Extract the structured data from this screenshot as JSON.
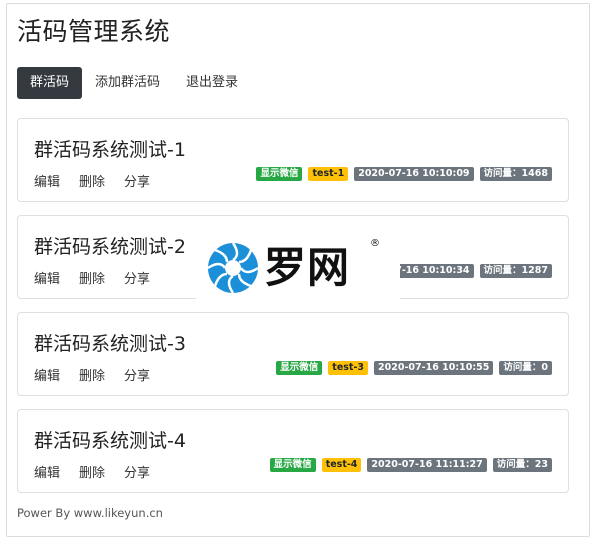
{
  "app": {
    "title": "活码管理系统"
  },
  "nav": {
    "items": [
      {
        "label": "群活码",
        "active": true
      },
      {
        "label": "添加群活码",
        "active": false
      },
      {
        "label": "退出登录",
        "active": false
      }
    ]
  },
  "actions": {
    "edit": "编辑",
    "delete": "删除",
    "share": "分享"
  },
  "cards": [
    {
      "title": "群活码系统测试-1",
      "wechat": "显示微信",
      "tag": "test-1",
      "time": "2020-07-16 10:10:09",
      "visits": "访问量：1468"
    },
    {
      "title": "群活码系统测试-2",
      "wechat": "",
      "tag": "",
      "time": "07-16 10:10:34",
      "visits": "访问量：1287"
    },
    {
      "title": "群活码系统测试-3",
      "wechat": "显示微信",
      "tag": "test-3",
      "time": "2020-07-16 10:10:55",
      "visits": "访问量：0"
    },
    {
      "title": "群活码系统测试-4",
      "wechat": "显示微信",
      "tag": "test-4",
      "time": "2020-07-16 11:11:27",
      "visits": "访问量：23"
    }
  ],
  "footer": {
    "text": "Power By www.likeyun.cn"
  },
  "watermark": {
    "text": "罗网",
    "reg": "®"
  },
  "colors": {
    "nav_active": "#343a40",
    "badge_green": "#28a745",
    "badge_yellow": "#ffc107",
    "badge_gray": "#6c757d",
    "logo_blue": "#1b8fd8"
  }
}
